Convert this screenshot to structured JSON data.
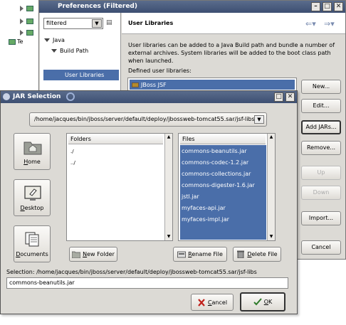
{
  "background_workspace": {
    "tree_partial_label": "Te"
  },
  "preferences": {
    "title": "Preferences (Filtered)",
    "filter": {
      "value": "filtered"
    },
    "nav": {
      "java": "Java",
      "build_path": "Build Path",
      "user_libraries": "User Libraries"
    },
    "page_title": "User Libraries",
    "description": "User libraries can be added to a Java Build path and bundle a number of external archives. System libraries will be added to the boot class path when launched.",
    "defined_label": "Defined user libraries:",
    "libraries": [
      "JBoss JSF"
    ],
    "buttons": {
      "new": "New...",
      "edit": "Edit...",
      "add_jars": "Add JARs...",
      "remove": "Remove...",
      "up": "Up",
      "down": "Down",
      "import": "Import...",
      "cancel": "Cancel"
    }
  },
  "jar_selection": {
    "title": "JAR Selection",
    "path": "/home/jacques/bin/jboss/server/default/deploy/jbossweb-tomcat55.sar/jsf-libs",
    "places": [
      "Home",
      "Desktop",
      "Documents"
    ],
    "folders_header": "Folders",
    "folders": [
      "./",
      "../"
    ],
    "files_header": "Files",
    "files": [
      "commons-beanutils.jar",
      "commons-codec-1.2.jar",
      "commons-collections.jar",
      "commons-digester-1.6.jar",
      "jstl.jar",
      "myfaces-api.jar",
      "myfaces-impl.jar"
    ],
    "buttons": {
      "new_folder": "New Folder",
      "rename_file": "Rename File",
      "delete_file": "Delete File",
      "cancel": "Cancel",
      "ok": "OK"
    },
    "selection_label": "Selection: /home/jacques/bin/jboss/server/default/deploy/jbossweb-tomcat55.sar/jsf-libs",
    "selection_value": "commons-beanutils.jar"
  },
  "colors": {
    "title_bar": "#3d4f72",
    "selection": "#4a6ea9",
    "window_bg": "#dcdad5"
  },
  "icons": [
    "minimize-icon",
    "maximize-icon",
    "close-icon",
    "dropdown-icon",
    "clear-filter-icon",
    "back-arrow-icon",
    "forward-arrow-icon",
    "jar-icon",
    "home-folder-icon",
    "desktop-icon",
    "documents-icon",
    "new-folder-icon",
    "rename-icon",
    "delete-icon",
    "cancel-icon",
    "ok-icon"
  ]
}
